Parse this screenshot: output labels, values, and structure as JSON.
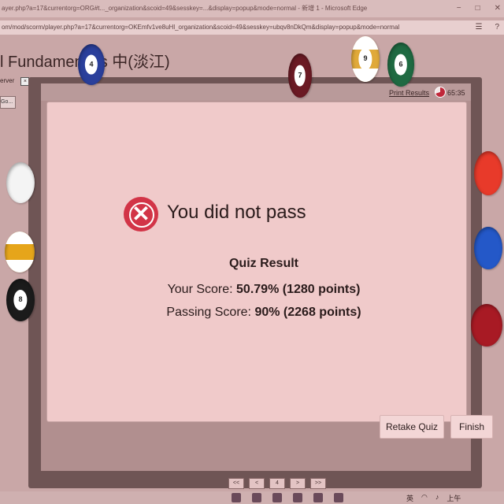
{
  "window": {
    "title": "ayer.php?a=17&currentorg=ORG#t..._organization&scoid=49&sesskey=...&display=popup&mode=normal - 新增 1 - Microsoft Edge",
    "controls": [
      "−",
      "□",
      "✕"
    ]
  },
  "address": {
    "url": "om/mod/scorm/player.php?a=17&currentorg=OKEmfv1ve8uHl_organization&scoid=49&sesskey=ubqv8nDkQm&display=popup&mode=normal"
  },
  "course": {
    "title": "l Fundamentals 中(淡江)"
  },
  "sidebar": {
    "server_label": "erver",
    "close_glyph": "×",
    "go_label": "Go..."
  },
  "player": {
    "print_results": "Print Results",
    "timer": "65:35"
  },
  "result": {
    "heading": "You did not pass",
    "quiz_result_title": "Quiz Result",
    "your_score_label": "Your Score: ",
    "your_score_value": "50.79% (1280 points)",
    "passing_score_label": "Passing Score: ",
    "passing_score_value": "90% (2268 points)"
  },
  "buttons": {
    "retake": "Retake Quiz",
    "finish": "Finish"
  },
  "pager": [
    "<<",
    "<",
    "4",
    ">",
    ">>"
  ],
  "tray": {
    "lang": "英",
    "time": "上午"
  },
  "balls": [
    {
      "label": "4",
      "color": "#2a3f9b",
      "striped": false
    },
    {
      "label": "7",
      "color": "#6b1a24",
      "striped": false
    },
    {
      "label": "9",
      "color": "#e0a93a",
      "striped": true
    },
    {
      "label": "6",
      "color": "#1f6a42",
      "striped": false
    },
    {
      "label": "",
      "color": "#f4f4f4",
      "striped": false
    },
    {
      "label": "",
      "color": "#e6a51a",
      "striped": true
    },
    {
      "label": "8",
      "color": "#1b1b1b",
      "striped": false
    },
    {
      "label": "",
      "color": "#e83a2a",
      "striped": false
    },
    {
      "label": "",
      "color": "#2458c8",
      "striped": false
    },
    {
      "label": "",
      "color": "#a81a24",
      "striped": false
    }
  ]
}
